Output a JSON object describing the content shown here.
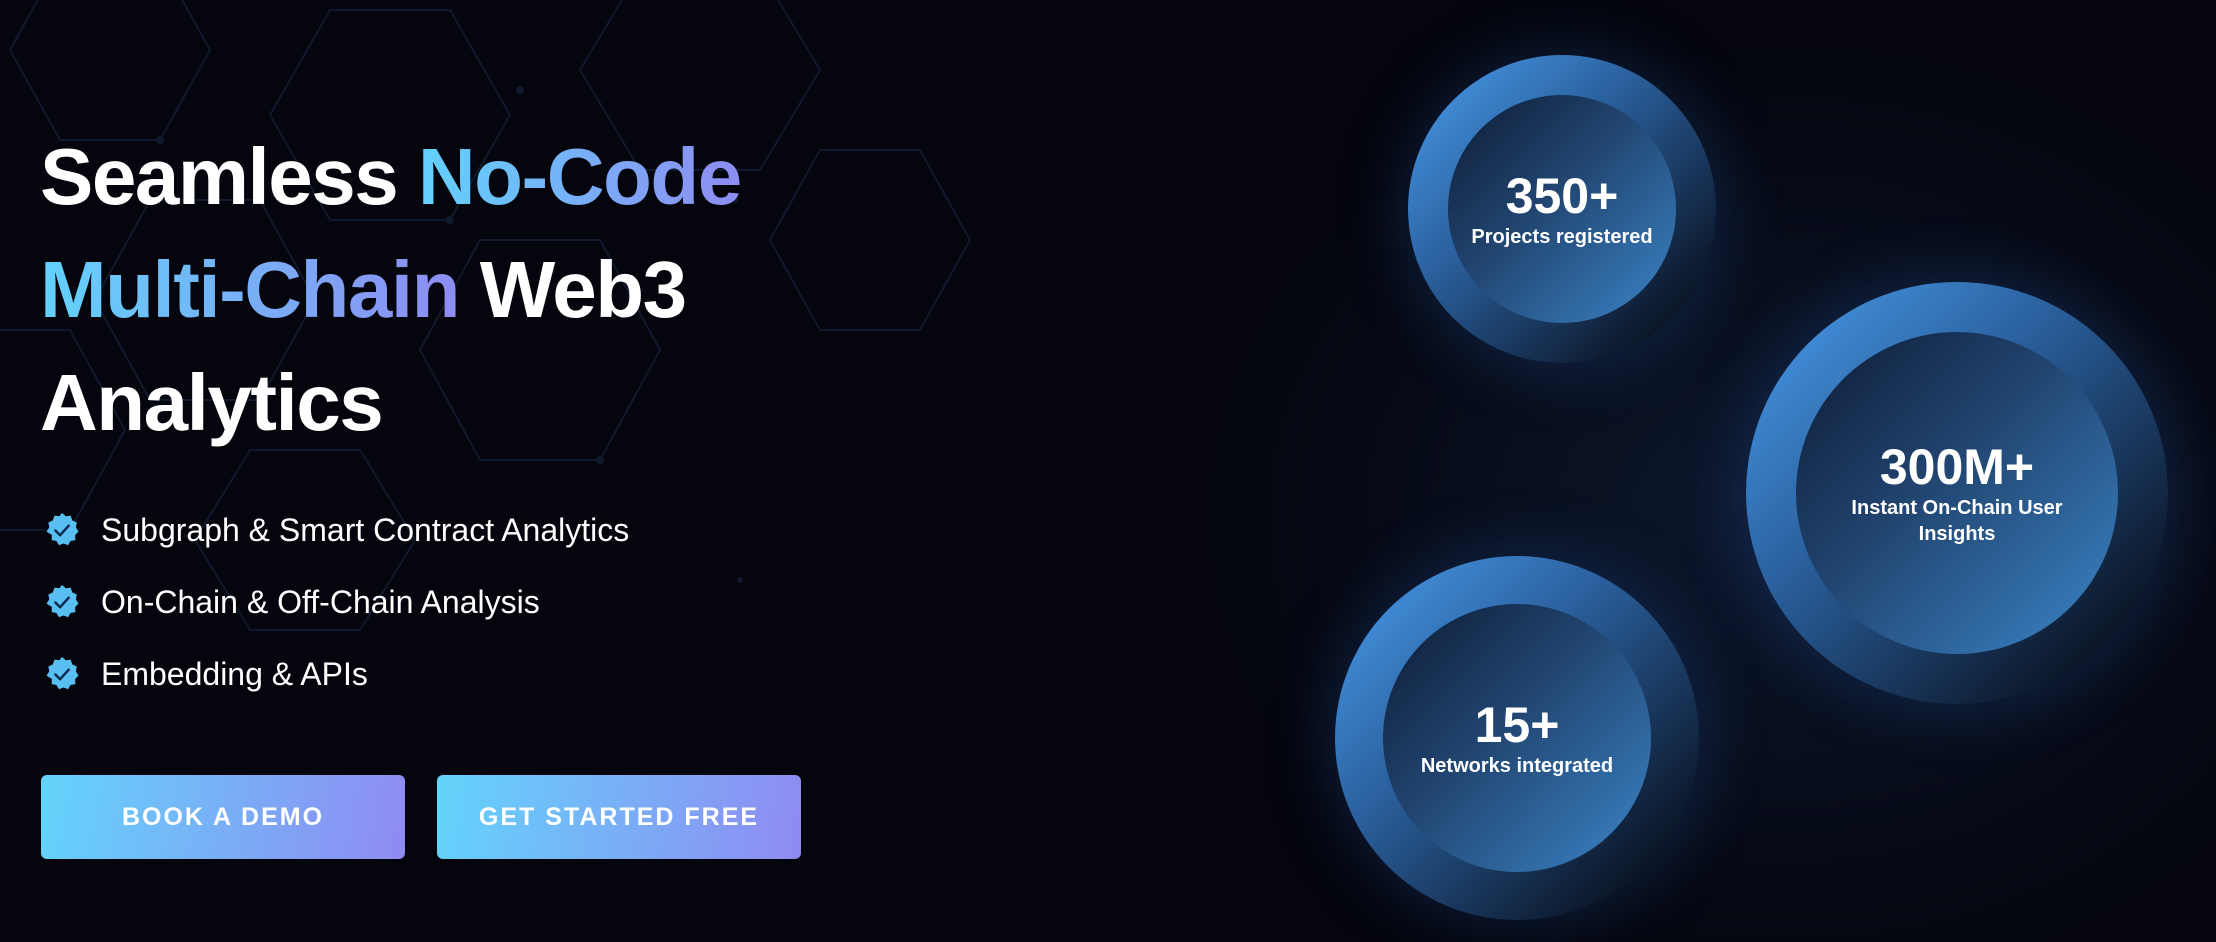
{
  "hero": {
    "headline": {
      "part1": "Seamless ",
      "part2": "No-Code",
      "part3": "Multi-Chain",
      "part4": " Web3",
      "part5": "Analytics"
    },
    "features": [
      {
        "icon": "verified-check-icon",
        "label": "Subgraph & Smart Contract Analytics"
      },
      {
        "icon": "verified-check-icon",
        "label": "On-Chain & Off-Chain Analysis"
      },
      {
        "icon": "verified-check-icon",
        "label": "Embedding & APIs"
      }
    ],
    "buttons": {
      "book_demo": "BOOK A DEMO",
      "get_started": "GET STARTED FREE"
    }
  },
  "stats": [
    {
      "value": "350+",
      "label": "Projects registered"
    },
    {
      "value": "300M+",
      "label": "Instant On-Chain User Insights"
    },
    {
      "value": "15+",
      "label": "Networks integrated"
    }
  ],
  "colors": {
    "background": "#04050d",
    "gradient_start": "#62d2fb",
    "gradient_end": "#8e8cf2",
    "circle_blue": "#4a9ff0"
  }
}
